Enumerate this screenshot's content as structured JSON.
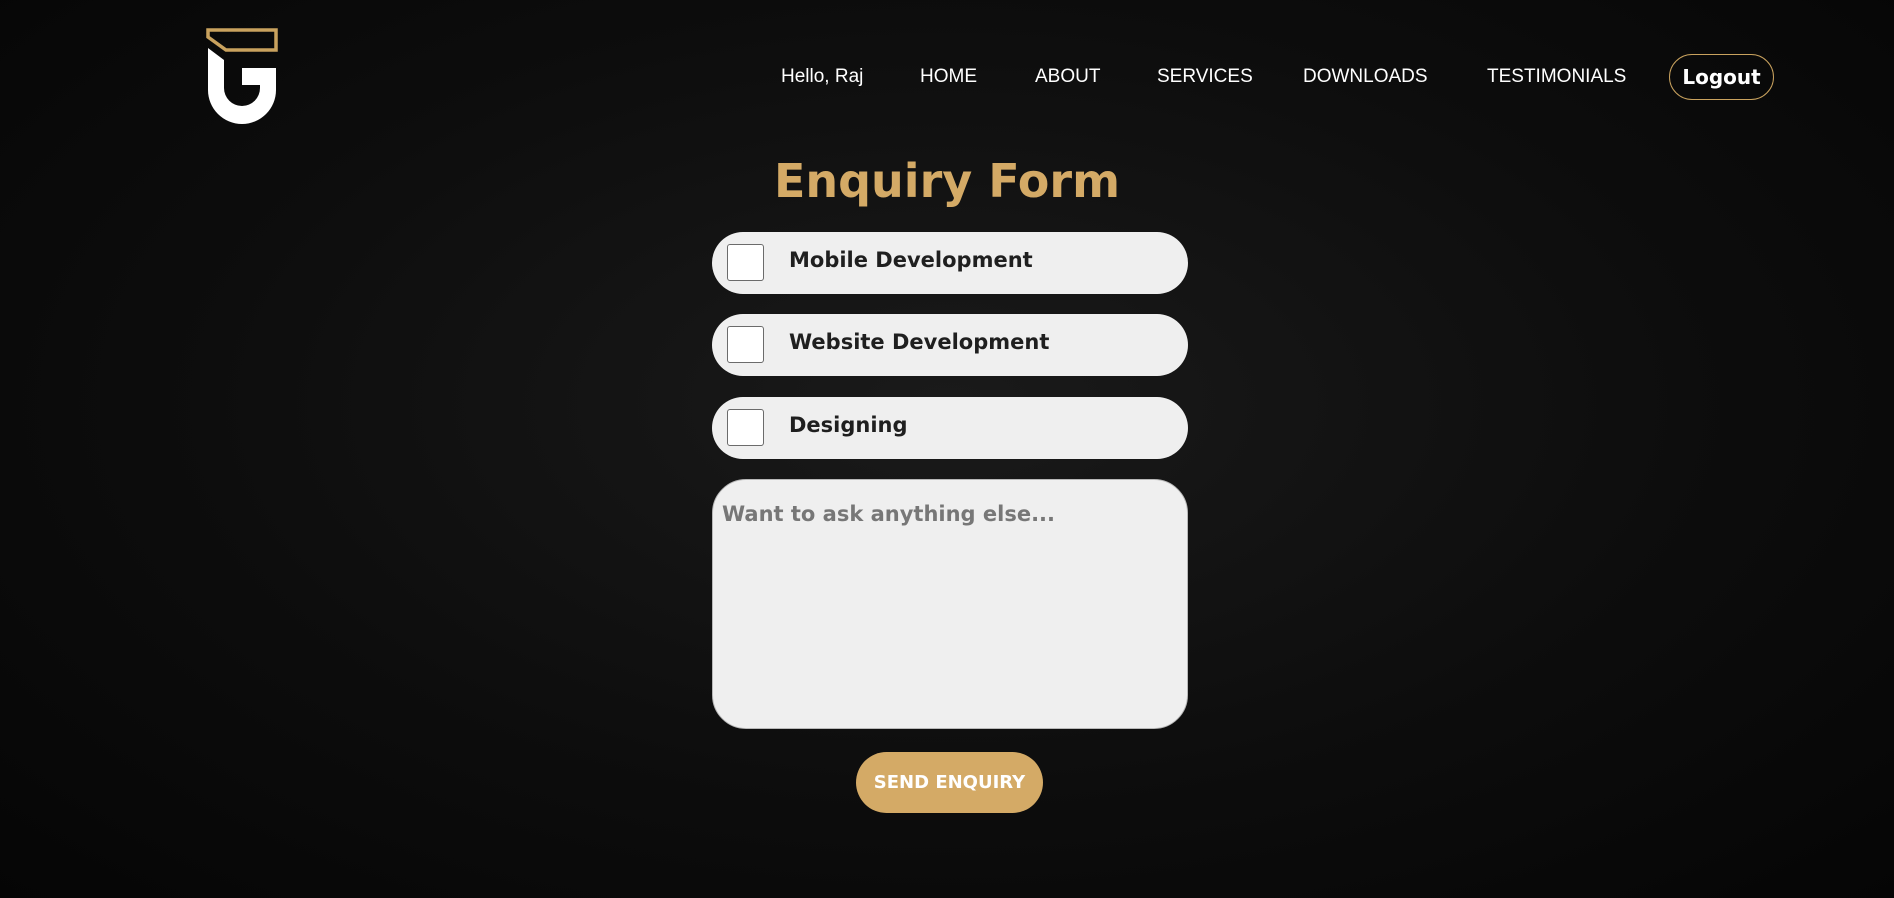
{
  "brand": {
    "logo_icon": "g-letter-logo-icon",
    "accent_color": "#d4aa66"
  },
  "nav": {
    "greeting": "Hello, Raj",
    "items": [
      {
        "label": "HOME"
      },
      {
        "label": "ABOUT"
      },
      {
        "label": "SERVICES"
      },
      {
        "label": "DOWNLOADS"
      },
      {
        "label": "TESTIMONIALS"
      }
    ],
    "logout_label": "Logout"
  },
  "form": {
    "title": "Enquiry Form",
    "options": [
      {
        "label": "Mobile Development",
        "checked": false
      },
      {
        "label": "Website Development",
        "checked": false
      },
      {
        "label": "Designing",
        "checked": false
      }
    ],
    "message_placeholder": "Want to ask anything else...",
    "message_value": "",
    "submit_label": "SEND ENQUIRY"
  }
}
